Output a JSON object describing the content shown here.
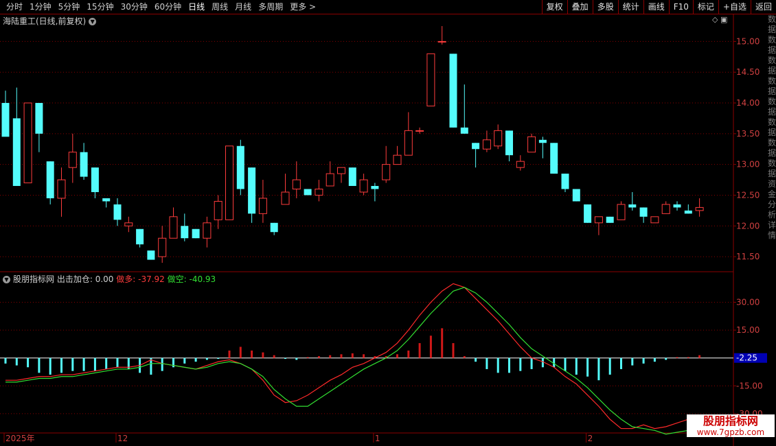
{
  "toolbar": {
    "periods": [
      "分时",
      "1分钟",
      "5分钟",
      "15分钟",
      "30分钟",
      "60分钟",
      "日线",
      "周线",
      "月线",
      "多周期",
      "更多 >"
    ],
    "active_period": "日线",
    "buttons": [
      "复权",
      "叠加",
      "多股",
      "统计",
      "画线",
      "F10",
      "标记",
      "+自选",
      "返回"
    ]
  },
  "main_chart": {
    "title": "海陆重工(日线,前复权)",
    "y_ticks": [
      "15.00",
      "14.50",
      "14.00",
      "13.50",
      "13.00",
      "12.50",
      "12.00",
      "11.50"
    ]
  },
  "indicator": {
    "name": "股朋指标网",
    "label1": "出击加仓: 0.00",
    "label2": "做多: -37.92",
    "label3": "做空: -40.93",
    "y_ticks": [
      "30.00",
      "15.00",
      "-15.00",
      "-30.00"
    ],
    "current_value": "-2.25"
  },
  "x_axis": {
    "labels": [
      "2025年",
      "12",
      "1",
      "2"
    ]
  },
  "sidebar_text": "数据数据数据数据数据数据数据数据资金分析详情",
  "watermark": {
    "line1": "股朋指标网",
    "line2": "www.7gpzb.com"
  },
  "colors": {
    "up": "#ff3c3c",
    "down": "#54fcfc",
    "grid": "#8b0000",
    "line_red": "#ff2a2a",
    "line_green": "#32e032"
  },
  "chart_data": {
    "type": "candlestick",
    "ylim": [
      11.3,
      15.25
    ],
    "candles": [
      [
        14.0,
        14.2,
        13.8,
        13.45
      ],
      [
        13.75,
        14.25,
        12.65,
        12.65
      ],
      [
        12.7,
        14.0,
        12.7,
        14.0
      ],
      [
        14.0,
        14.0,
        13.2,
        13.5
      ],
      [
        13.05,
        13.05,
        12.35,
        12.45
      ],
      [
        12.45,
        12.95,
        12.15,
        12.75
      ],
      [
        12.95,
        13.5,
        12.7,
        13.2
      ],
      [
        13.2,
        13.35,
        12.75,
        12.8
      ],
      [
        12.95,
        12.95,
        12.45,
        12.55
      ],
      [
        12.45,
        12.45,
        12.3,
        12.4
      ],
      [
        12.35,
        12.45,
        12.0,
        12.1
      ],
      [
        12.0,
        12.15,
        11.9,
        12.05
      ],
      [
        11.95,
        11.95,
        11.65,
        11.7
      ],
      [
        11.6,
        11.6,
        11.45,
        11.45
      ],
      [
        11.5,
        12.0,
        11.4,
        11.8
      ],
      [
        11.8,
        12.3,
        11.8,
        12.15
      ],
      [
        12.0,
        12.2,
        11.75,
        11.8
      ],
      [
        11.95,
        11.95,
        11.8,
        11.8
      ],
      [
        11.8,
        12.15,
        11.65,
        12.05
      ],
      [
        12.1,
        12.5,
        11.95,
        12.4
      ],
      [
        12.1,
        13.3,
        12.1,
        13.3
      ],
      [
        13.3,
        13.4,
        12.5,
        12.6
      ],
      [
        12.95,
        12.95,
        12.05,
        12.2
      ],
      [
        12.2,
        12.75,
        12.05,
        12.45
      ],
      [
        12.05,
        12.05,
        11.85,
        11.9
      ],
      [
        12.35,
        12.85,
        12.35,
        12.55
      ],
      [
        12.6,
        13.05,
        12.45,
        12.75
      ],
      [
        12.6,
        12.6,
        12.5,
        12.5
      ],
      [
        12.5,
        12.75,
        12.4,
        12.6
      ],
      [
        12.65,
        13.05,
        12.65,
        12.85
      ],
      [
        12.85,
        12.95,
        12.7,
        12.95
      ],
      [
        12.95,
        12.95,
        12.65,
        12.65
      ],
      [
        12.55,
        12.85,
        12.5,
        12.75
      ],
      [
        12.65,
        12.7,
        12.4,
        12.6
      ],
      [
        12.75,
        13.3,
        12.7,
        13.0
      ],
      [
        13.0,
        13.3,
        13.0,
        13.15
      ],
      [
        13.15,
        13.85,
        13.15,
        13.55
      ],
      [
        13.55,
        13.6,
        13.5,
        13.55
      ],
      [
        13.95,
        14.8,
        13.95,
        14.8
      ],
      [
        15.0,
        15.25,
        14.95,
        15.0
      ],
      [
        14.8,
        14.8,
        13.6,
        13.6
      ],
      [
        13.6,
        14.3,
        13.5,
        13.5
      ],
      [
        13.35,
        13.35,
        12.95,
        13.25
      ],
      [
        13.25,
        13.55,
        13.2,
        13.4
      ],
      [
        13.3,
        13.65,
        13.25,
        13.55
      ],
      [
        13.55,
        13.55,
        13.05,
        13.15
      ],
      [
        12.95,
        13.15,
        12.9,
        13.05
      ],
      [
        13.2,
        13.5,
        13.2,
        13.45
      ],
      [
        13.4,
        13.45,
        13.1,
        13.35
      ],
      [
        13.35,
        13.35,
        12.85,
        12.85
      ],
      [
        12.85,
        12.85,
        12.55,
        12.6
      ],
      [
        12.6,
        12.6,
        12.4,
        12.4
      ],
      [
        12.35,
        12.35,
        12.05,
        12.05
      ],
      [
        12.05,
        12.15,
        11.85,
        12.15
      ],
      [
        12.15,
        12.15,
        12.05,
        12.05
      ],
      [
        12.1,
        12.4,
        12.1,
        12.35
      ],
      [
        12.35,
        12.55,
        12.25,
        12.3
      ],
      [
        12.3,
        12.3,
        12.05,
        12.15
      ],
      [
        12.05,
        12.15,
        12.05,
        12.15
      ],
      [
        12.2,
        12.4,
        12.2,
        12.35
      ],
      [
        12.35,
        12.4,
        12.25,
        12.3
      ],
      [
        12.25,
        12.35,
        12.2,
        12.2
      ],
      [
        12.25,
        12.45,
        12.15,
        12.3
      ]
    ],
    "macd_hist": [
      -3,
      -4,
      -5,
      -8,
      -9,
      -8,
      -7,
      -7,
      -7,
      -6,
      -5,
      -6,
      -8,
      -9,
      -7,
      -5,
      -3,
      -2,
      -1,
      -0.5,
      4,
      6,
      4,
      3,
      1.5,
      -0.5,
      -1,
      0.5,
      1,
      1.5,
      2,
      2.5,
      2,
      1,
      1,
      2,
      4,
      8,
      12,
      16,
      8,
      1,
      -2,
      -6,
      -8,
      -8,
      -7,
      -6,
      -5,
      -5,
      -7,
      -9,
      -10,
      -12,
      -9,
      -6,
      -4,
      -3,
      -2,
      -1,
      0.5,
      0.5,
      1.5
    ],
    "line_red": [
      -12,
      -12,
      -11,
      -10,
      -10,
      -9,
      -9,
      -8,
      -7,
      -6,
      -5,
      -5,
      -4,
      -1,
      -3,
      -4,
      -5,
      -6,
      -4,
      -2,
      -1,
      -3,
      -6,
      -12,
      -20,
      -24,
      -23,
      -20,
      -16,
      -12,
      -9,
      -5,
      -3,
      0,
      3,
      8,
      15,
      23,
      30,
      36,
      40,
      38,
      32,
      26,
      20,
      13,
      6,
      0,
      -2,
      -5,
      -10,
      -14,
      -20,
      -26,
      -33,
      -38,
      -38,
      -36,
      -38,
      -37,
      -35,
      -33,
      -31
    ],
    "line_green": [
      -13,
      -13,
      -12,
      -11,
      -11,
      -10,
      -10,
      -9,
      -8,
      -7,
      -6,
      -6,
      -5,
      -3,
      -3,
      -4,
      -5,
      -6,
      -5,
      -3,
      -2,
      -3,
      -6,
      -10,
      -17,
      -22,
      -26,
      -26,
      -22,
      -18,
      -14,
      -10,
      -6,
      -3,
      0,
      4,
      10,
      17,
      24,
      30,
      36,
      38,
      35,
      30,
      24,
      18,
      11,
      5,
      1,
      -3,
      -7,
      -11,
      -16,
      -22,
      -28,
      -33,
      -37,
      -38,
      -39,
      -41,
      -40,
      -39,
      -38
    ],
    "xlabels_at": [
      [
        0,
        "2025年"
      ],
      [
        10,
        "12"
      ],
      [
        33,
        "1"
      ],
      [
        52,
        "2"
      ]
    ]
  }
}
